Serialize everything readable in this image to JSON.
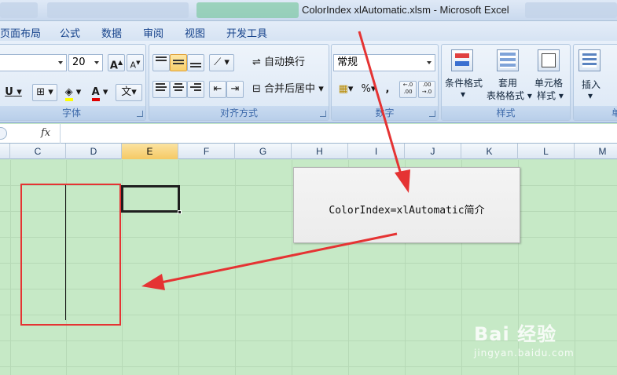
{
  "window": {
    "title": "ColorIndex xlAutomatic.xlsm - Microsoft Excel"
  },
  "menu": {
    "items": [
      "页面布局",
      "公式",
      "数据",
      "审阅",
      "视图",
      "开发工具"
    ]
  },
  "ribbon": {
    "font": {
      "font_size": "20",
      "group_label": "字体",
      "grow_font": "A",
      "shrink_font": "A",
      "underline": "U",
      "font_color": "A",
      "phonetic": "文"
    },
    "alignment": {
      "wrap_text": "自动换行",
      "merge_center": "合并后居中",
      "group_label": "对齐方式"
    },
    "number": {
      "format_value": "常规",
      "percent": "%",
      "comma": ",",
      "inc_decimal": "←.0\n.00",
      "dec_decimal": ".00\n→.0",
      "group_label": "数字"
    },
    "styles": {
      "conditional_format": "条件格式",
      "format_as_table_1": "套用",
      "format_as_table_2": "表格格式",
      "cell_styles_1": "单元格",
      "cell_styles_2": "样式",
      "group_label": "样式"
    },
    "cells": {
      "insert": "插入",
      "group_label": "单"
    }
  },
  "formula_bar": {
    "fx": "fx",
    "value": ""
  },
  "columns": [
    "C",
    "D",
    "E",
    "F",
    "G",
    "H",
    "I",
    "J",
    "K",
    "L",
    "M"
  ],
  "selected_column": "E",
  "callout": {
    "text": "ColorIndex=xlAutomatic简介"
  },
  "watermark": {
    "main": "Bai 经验",
    "sub": "jingyan.baidu.com"
  },
  "colors": {
    "arrow": "#e53333",
    "sheet_bg": "#c6e9c6",
    "ribbon_accent": "#f8cf6b"
  }
}
